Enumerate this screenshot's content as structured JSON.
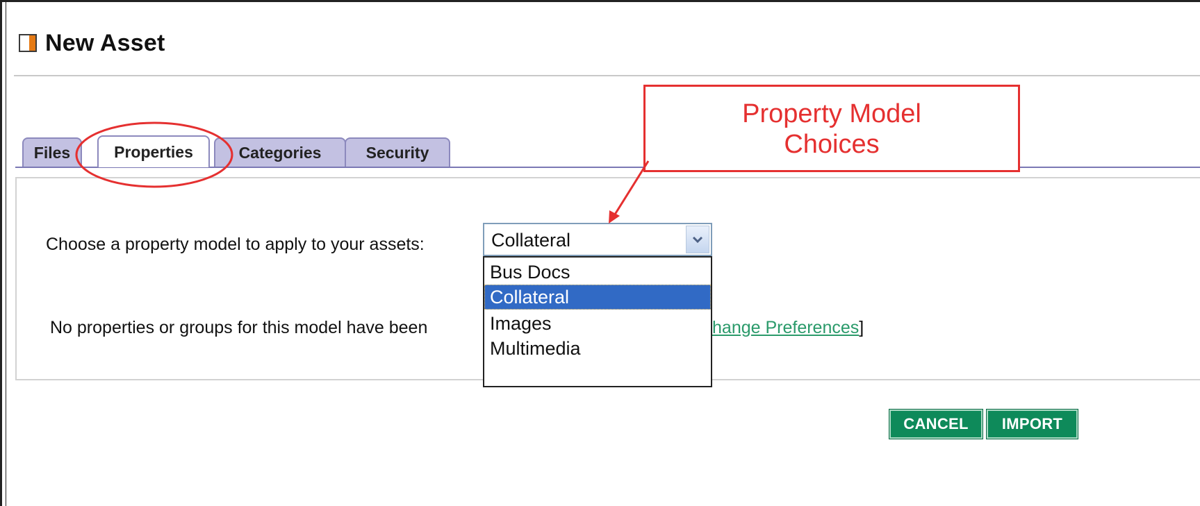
{
  "header": {
    "title": "New Asset",
    "icon": "asset-icon"
  },
  "tabs": [
    {
      "label": "Files",
      "active": false
    },
    {
      "label": "Properties",
      "active": true
    },
    {
      "label": "Categories",
      "active": false
    },
    {
      "label": "Security",
      "active": false
    }
  ],
  "form": {
    "prompt": "Choose a property model to apply to your assets:",
    "select": {
      "value": "Collateral",
      "options": [
        "Bus Docs",
        "Collateral",
        "Images",
        "Multimedia"
      ],
      "selected_index": 1
    },
    "note": "No properties or groups for this model have been",
    "link_prefix": "[",
    "link_label": "Change Preferences",
    "link_suffix": "]"
  },
  "callout": {
    "line1": "Property Model",
    "line2": "Choices"
  },
  "actions": {
    "cancel": "CANCEL",
    "import": "IMPORT"
  },
  "colors": {
    "accent_orange": "#e57a14",
    "tab_fill": "#c3c1e2",
    "button_green": "#0e8a5a",
    "annotation_red": "#e53030",
    "selection_blue": "#316ac5"
  }
}
